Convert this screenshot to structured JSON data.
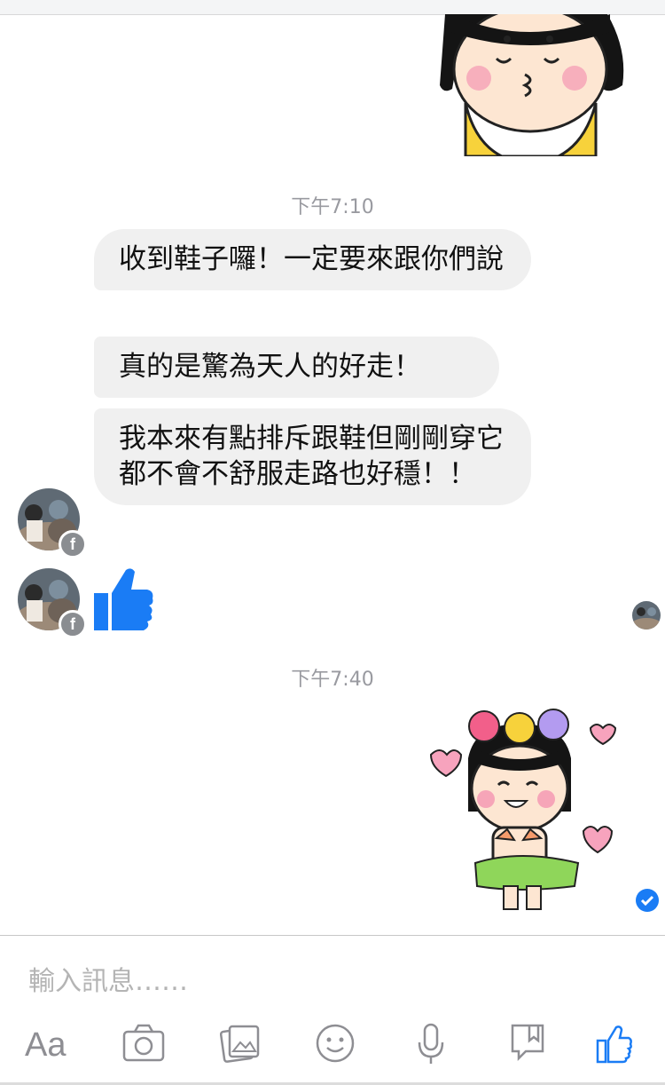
{
  "timestamps": [
    "下午7:10",
    "下午7:40"
  ],
  "messages": [
    {
      "text": "收到鞋子囉！一定要來跟你們說"
    },
    {
      "text": "真的是驚為天人的好走！"
    },
    {
      "text": "我本來有點排斥跟鞋但剛剛穿它都不會不舒服走路也好穩！！"
    }
  ],
  "composer": {
    "placeholder": "輸入訊息……",
    "toolbar": [
      {
        "name": "text-format",
        "label": "Aa",
        "icon": "aa-icon"
      },
      {
        "name": "camera",
        "icon": "camera-icon"
      },
      {
        "name": "photo",
        "icon": "gallery-icon"
      },
      {
        "name": "emoji",
        "icon": "smiley-icon"
      },
      {
        "name": "voice",
        "icon": "microphone-icon"
      },
      {
        "name": "sticker",
        "icon": "sticker-icon"
      },
      {
        "name": "like",
        "icon": "thumbs-up-icon"
      }
    ]
  },
  "colors": {
    "messenger_blue": "#1a7cf5",
    "bubble_gray": "#f0f0f0",
    "icon_gray": "#8e8e93"
  }
}
